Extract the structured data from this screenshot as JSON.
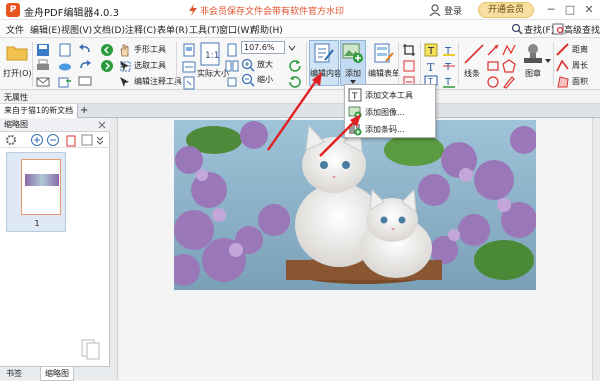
{
  "titlebar": {
    "logo_glyph": "P",
    "app_title": "金舟PDF编辑器4.0.3",
    "banner": "非会员保存文件会带有软件官方水印",
    "login": "登录",
    "vip_button": "开通会员",
    "win_min": "─",
    "win_max": "□",
    "win_close": "✕"
  },
  "menubar": {
    "items": [
      "文件",
      "编辑(E)",
      "视图(V)",
      "文档(D)",
      "注释(C)",
      "表单(R)",
      "工具(T)",
      "窗口(W)",
      "帮助(H)"
    ],
    "find": "查找(F)",
    "advanced_find": "高级查找"
  },
  "toolbar": {
    "open": "打开(O)",
    "hand_tool": "手形工具",
    "select_tool": "选取工具",
    "edit_annotation_tool": "编辑注释工具",
    "actual_size": "实际大小",
    "zoom_value": "107.6%",
    "zoom_in": "放大",
    "zoom_out": "缩小",
    "edit_content": "编辑内容",
    "add": "添加",
    "edit_form": "编辑表单",
    "line": "线条",
    "stamp": "图章",
    "distance": "距离",
    "perimeter": "周长",
    "area": "面积"
  },
  "propbar": {
    "label": "无属性"
  },
  "tabbar": {
    "doc_tab": "来自于猫1的新文档",
    "add_tab": "+"
  },
  "leftpanel": {
    "title": "缩略图",
    "page_number": "1",
    "tab_bookmarks": "书签",
    "tab_thumbnails": "缩略图"
  },
  "dropdown": {
    "items": [
      {
        "label": "添加文本工具",
        "icon": "text-tool-icon"
      },
      {
        "label": "添加图像...",
        "icon": "image-icon"
      },
      {
        "label": "添加条码...",
        "icon": "barcode-icon"
      }
    ]
  },
  "colors": {
    "accent_orange": "#e8541e",
    "arrow_red": "#e02020",
    "vip_gold": "#f7dfa1",
    "selection_blue": "#cfe3f5"
  }
}
